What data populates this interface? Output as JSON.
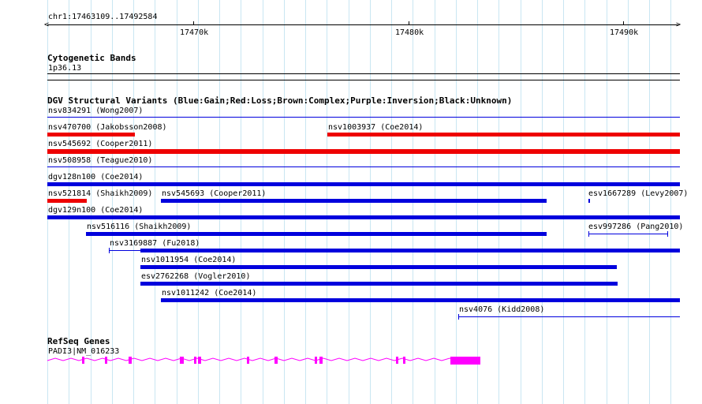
{
  "ruler": {
    "location": "chr1:17463109..17492584",
    "ticks": [
      "17470k",
      "17480k",
      "17490k"
    ]
  },
  "cytoband": {
    "title": "Cytogenetic Bands",
    "band_label": "1p36.13"
  },
  "dgv": {
    "title": "DGV Structural Variants (Blue:Gain;Red:Loss;Brown:Complex;Purple:Inversion;Black:Unknown)",
    "legend_colors": {
      "gain": "#0000dd",
      "loss": "#ee0000",
      "complex": "#8b4513",
      "inversion": "#800080",
      "unknown": "#000000"
    },
    "variants": [
      {
        "label": "nsv834291 (Wong2007)",
        "type": "gain"
      },
      {
        "label": "nsv470700 (Jakobsson2008)",
        "type": "loss"
      },
      {
        "label": "nsv1003937 (Coe2014)",
        "type": "loss"
      },
      {
        "label": "nsv545692 (Cooper2011)",
        "type": "loss"
      },
      {
        "label": "nsv508958 (Teague2010)",
        "type": "gain"
      },
      {
        "label": "dgv128n100 (Coe2014)",
        "type": "gain"
      },
      {
        "label": "nsv521814 (Shaikh2009)",
        "type": "loss"
      },
      {
        "label": "nsv545693 (Cooper2011)",
        "type": "gain"
      },
      {
        "label": "esv1667289 (Levy2007)",
        "type": "gain"
      },
      {
        "label": "dgv129n100 (Coe2014)",
        "type": "gain"
      },
      {
        "label": "nsv516116 (Shaikh2009)",
        "type": "gain"
      },
      {
        "label": "esv997286 (Pang2010)",
        "type": "gain"
      },
      {
        "label": "nsv3169887 (Fu2018)",
        "type": "gain"
      },
      {
        "label": "nsv1011954 (Coe2014)",
        "type": "gain"
      },
      {
        "label": "esv2762268 (Vogler2010)",
        "type": "gain"
      },
      {
        "label": "nsv1011242 (Coe2014)",
        "type": "gain"
      },
      {
        "label": "nsv4076 (Kidd2008)",
        "type": "gain"
      }
    ]
  },
  "refseq": {
    "title": "RefSeq Genes",
    "gene_label": "PADI3|NM_016233",
    "gene_color": "#ff00ff"
  }
}
